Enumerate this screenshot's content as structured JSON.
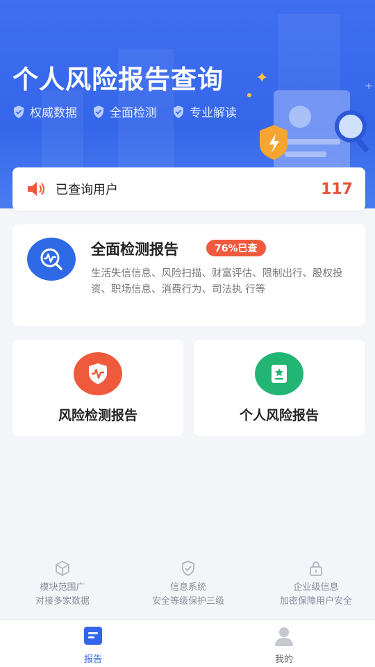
{
  "header": {
    "title": "个人风险报告查询",
    "tags": [
      "权威数据",
      "全面检测",
      "专业解读"
    ]
  },
  "users": {
    "label": "已查询用户",
    "count": "117"
  },
  "full_report": {
    "title": "全面检测报告",
    "badge": "76%已查",
    "description": "生活失信信息、风险扫描、财富评估、限制出行、股权投资、职场信息、消费行为、司法执 行等"
  },
  "cards": [
    {
      "title": "风险检测报告",
      "color": "#f05a3c"
    },
    {
      "title": "个人风险报告",
      "color": "#22b573"
    }
  ],
  "assurances": [
    {
      "line1": "模块范围广",
      "line2": "对接多家数据"
    },
    {
      "line1": "信息系统",
      "line2": "安全等级保护三级"
    },
    {
      "line1": "企业级信息",
      "line2": "加密保障用户安全"
    }
  ],
  "tabs": [
    {
      "label": "报告",
      "active": true
    },
    {
      "label": "我的",
      "active": false
    }
  ],
  "colors": {
    "primary": "#3566ea",
    "accent": "#e8523a",
    "tab_active": "#3566ea",
    "tab_inactive": "#666666"
  }
}
